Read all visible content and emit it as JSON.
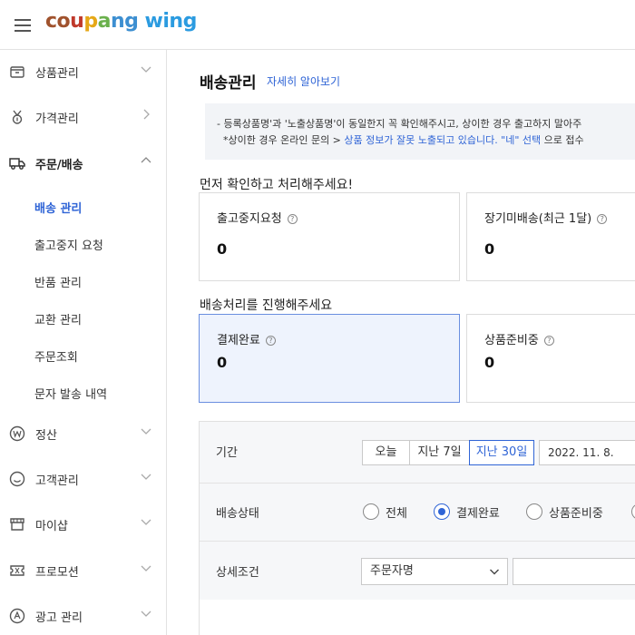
{
  "brand": {
    "logo_parts": [
      "c",
      "o",
      "u",
      "p",
      "a",
      "n",
      "g"
    ],
    "logo_wing": "wing",
    "colors": {
      "accent": "#2f64d6",
      "selected_card_bg": "#eef3fd"
    }
  },
  "topbar": {
    "menu_icon": "hamburger-icon"
  },
  "sidebar": {
    "items": [
      {
        "label": "상품관리",
        "icon": "box-icon"
      },
      {
        "label": "가격관리",
        "icon": "medal-icon"
      },
      {
        "label": "주문/배송",
        "icon": "truck-icon"
      },
      {
        "label": "정산",
        "icon": "won-icon"
      },
      {
        "label": "고객관리",
        "icon": "smile-icon"
      },
      {
        "label": "마이샵",
        "icon": "shop-icon"
      },
      {
        "label": "프로모션",
        "icon": "ticket-icon"
      },
      {
        "label": "광고 관리",
        "icon": "ad-icon"
      }
    ],
    "sub_items": [
      {
        "label": "배송 관리",
        "active": true
      },
      {
        "label": "출고중지 요청"
      },
      {
        "label": "반품 관리"
      },
      {
        "label": "교환 관리"
      },
      {
        "label": "주문조회"
      },
      {
        "label": "문자 발송 내역"
      }
    ]
  },
  "main": {
    "title": "배송관리",
    "learn_more": "자세히 알아보기",
    "notice": {
      "line1": "- 등록상품명'과 '노출상품명'이 동일한지 꼭 확인해주시고, 상이한 경우 출고하지 말아주",
      "line2_a": "*상이한 경우 온라인 문의 > ",
      "line2_link": "상품 정보가 잘못 노출되고 있습니다. \"네\" 선택",
      "line2_b": " 으로 접수"
    },
    "section1_label": "먼저 확인하고 처리해주세요!",
    "section1_cards": [
      {
        "title": "출고중지요청",
        "value": "0"
      },
      {
        "title": "장기미배송(최근 1달)",
        "value": "0"
      }
    ],
    "section2_label": "배송처리를 진행해주세요",
    "section2_cards": [
      {
        "title": "결제완료",
        "value": "0",
        "selected": true
      },
      {
        "title": "상품준비중",
        "value": "0"
      }
    ],
    "filter": {
      "period_label": "기간",
      "period_options": [
        "오늘",
        "지난 7일",
        "지난 30일"
      ],
      "period_selected": "지난 30일",
      "date_value": "2022. 11. 8.",
      "status_label": "배송상태",
      "status_options": [
        "전체",
        "결제완료",
        "상품준비중"
      ],
      "status_selected": "결제완료",
      "detail_label": "상세조건",
      "detail_select_value": "주문자명",
      "detail_input_value": ""
    }
  }
}
